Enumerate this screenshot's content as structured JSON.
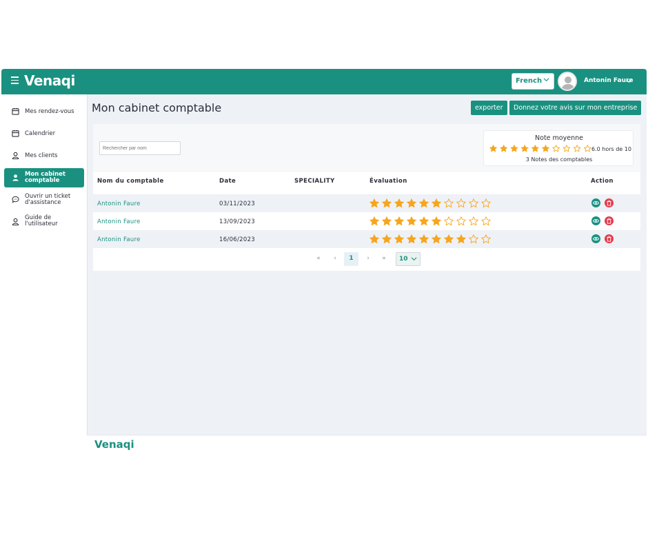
{
  "header": {
    "brand": "Venaqi",
    "language": "French",
    "user_name": "Antonin Faure",
    "icons": [
      "menu-icon",
      "chevron-down-icon",
      "avatar"
    ]
  },
  "sidebar": {
    "items": [
      {
        "label": "Mes rendez-vous",
        "icon": "calendar-icon"
      },
      {
        "label": "Calendrier",
        "icon": "calendar-icon"
      },
      {
        "label": "Mes clients",
        "icon": "user-icon"
      },
      {
        "label_line1": "Mon cabinet",
        "label_line2": "comptable",
        "icon": "user-icon",
        "active": true
      },
      {
        "label_line1": "Ouvrir un ticket",
        "label_line2": "d'assistance",
        "icon": "chat-icon"
      },
      {
        "label_line1": "Guide de",
        "label_line2": "l'utilisateur",
        "icon": "user-icon"
      }
    ]
  },
  "main": {
    "title": "Mon cabinet comptable",
    "export_label": "exporter",
    "review_label": "Donnez votre avis sur mon entreprise",
    "search_placeholder": "Rechercher par nom",
    "average": {
      "title": "Note moyenne",
      "rating": 6.0,
      "max": 10,
      "value_text": "6.0 hors de 10",
      "sub": "3 Notes des comptables"
    },
    "table": {
      "headers": [
        "Nom du comptable",
        "Date",
        "SPECIALITY",
        "Évaluation",
        "Action"
      ],
      "rows": [
        {
          "name": "Antonin Faure",
          "date": "03/11/2023",
          "speciality": "",
          "rating": 6,
          "max": 10
        },
        {
          "name": "Antonin Faure",
          "date": "13/09/2023",
          "speciality": "",
          "rating": 6,
          "max": 10
        },
        {
          "name": "Antonin Faure",
          "date": "16/06/2023",
          "speciality": "",
          "rating": 8,
          "max": 10
        }
      ]
    },
    "pagination": {
      "first": "«",
      "prev": "‹",
      "current": "1",
      "next": "›",
      "last": "»",
      "per_page": "10"
    }
  },
  "footer": {
    "brand": "Venaqi"
  },
  "colors": {
    "brand": "#1a9180",
    "star": "#f7a51c",
    "delete": "#e23b4b"
  }
}
